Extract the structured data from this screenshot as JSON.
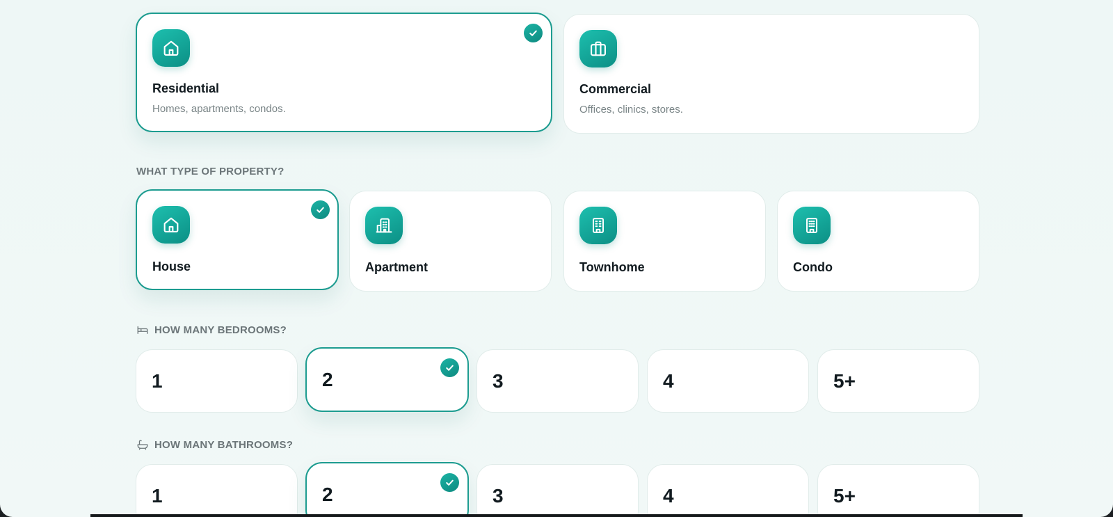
{
  "category": {
    "options": [
      {
        "title": "Residential",
        "subtitle": "Homes, apartments, condos.",
        "icon": "home-icon",
        "selected": true
      },
      {
        "title": "Commercial",
        "subtitle": "Offices, clinics, stores.",
        "icon": "briefcase-icon",
        "selected": false
      }
    ]
  },
  "property_type": {
    "label": "WHAT TYPE OF PROPERTY?",
    "options": [
      {
        "title": "House",
        "icon": "home-icon",
        "selected": true
      },
      {
        "title": "Apartment",
        "icon": "apartment-building-icon",
        "selected": false
      },
      {
        "title": "Townhome",
        "icon": "townhome-building-icon",
        "selected": false
      },
      {
        "title": "Condo",
        "icon": "condo-building-icon",
        "selected": false
      }
    ]
  },
  "bedrooms": {
    "label": "HOW MANY BEDROOMS?",
    "icon": "bed-icon",
    "options": [
      "1",
      "2",
      "3",
      "4",
      "5+"
    ],
    "selected": "2"
  },
  "bathrooms": {
    "label": "HOW MANY BATHROOMS?",
    "icon": "bathtub-icon",
    "options": [
      "1",
      "2",
      "3",
      "4",
      "5+"
    ],
    "selected": "2"
  },
  "colors": {
    "accent": "#1d9c90",
    "icon_gradient_start": "#1dbfae",
    "icon_gradient_end": "#0c8f85",
    "background": "#eef7f6",
    "card_border": "#e1ecea"
  }
}
